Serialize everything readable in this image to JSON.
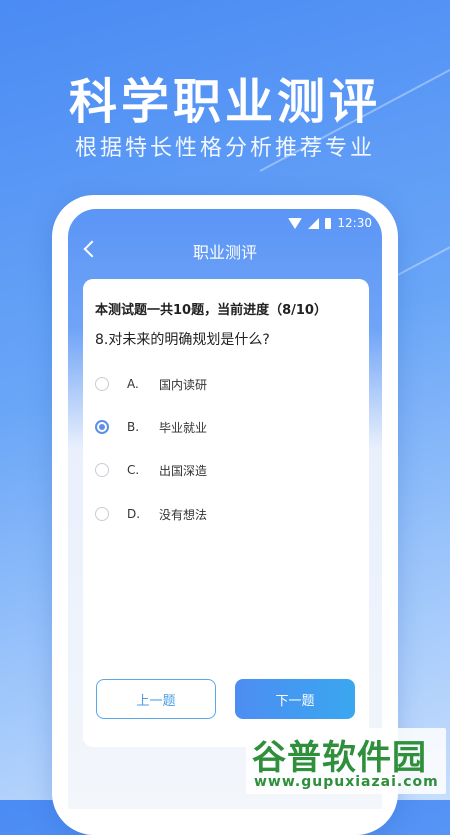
{
  "hero": {
    "title": "科学职业测评",
    "subtitle": "根据特长性格分析推荐专业"
  },
  "statusbar": {
    "time": "12:30",
    "icons": [
      "wifi-icon",
      "signal-icon",
      "battery-icon"
    ]
  },
  "nav": {
    "back_icon": "chevron-left-icon",
    "title": "职业测评"
  },
  "quiz": {
    "progress_text": "本测试题一共10题，当前进度（8/10）",
    "current": 8,
    "total": 10,
    "question": "8.对未来的明确规划是什么?",
    "options": [
      {
        "letter": "A.",
        "text": "国内读研",
        "selected": false
      },
      {
        "letter": "B.",
        "text": "毕业就业",
        "selected": true
      },
      {
        "letter": "C.",
        "text": "出国深造",
        "selected": false
      },
      {
        "letter": "D.",
        "text": "没有想法",
        "selected": false
      }
    ]
  },
  "buttons": {
    "prev": "上一题",
    "next": "下一题"
  },
  "watermark": {
    "title": "谷普软件园",
    "url": "www.gupuxiazai.com"
  },
  "colors": {
    "accent": "#5b8fe8",
    "hero_bg": "#4a8bf4",
    "watermark": "#2f8f3a"
  }
}
